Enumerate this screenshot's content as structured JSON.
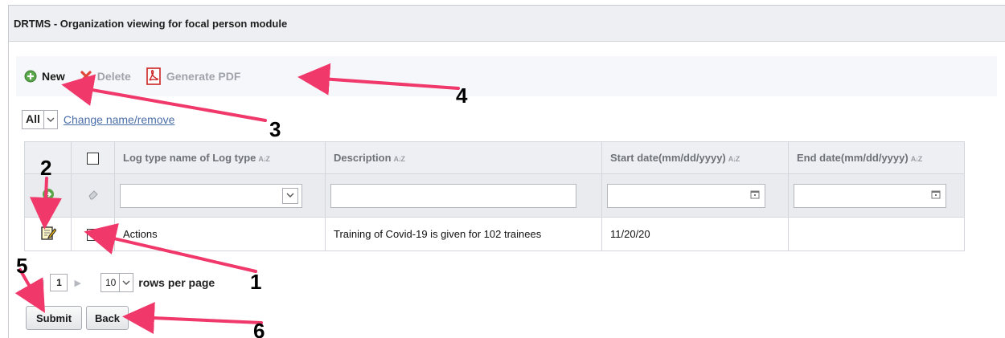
{
  "window": {
    "title": "DRTMS - Organization viewing for focal person module"
  },
  "toolbar": {
    "new_label": "New",
    "new_icon": "add-circle-icon",
    "delete_label": "Delete",
    "delete_icon": "delete-x-icon",
    "pdf_label": "Generate PDF",
    "pdf_icon": "pdf-icon"
  },
  "filter_bar": {
    "select_value": "All",
    "change_link": "Change name/remove"
  },
  "grid": {
    "columns": [
      {
        "label": "Log type name of Log type"
      },
      {
        "label": "Description"
      },
      {
        "label": "Start date(mm/dd/yyyy)"
      },
      {
        "label": "End date(mm/dd/yyyy)"
      }
    ],
    "rows": [
      {
        "log_type": "Actions",
        "description": "Training of Covid-19 is given for 102 trainees",
        "start_date": "11/20/20",
        "end_date": ""
      }
    ]
  },
  "pager": {
    "page": "1",
    "page_size": "10",
    "rows_label": "rows per page"
  },
  "buttons": {
    "submit": "Submit",
    "back": "Back"
  },
  "annotations": {
    "n1": "1",
    "n2": "2",
    "n3": "3",
    "n4": "4",
    "n5": "5",
    "n6": "6",
    "arrow_color": "#f0386b"
  }
}
